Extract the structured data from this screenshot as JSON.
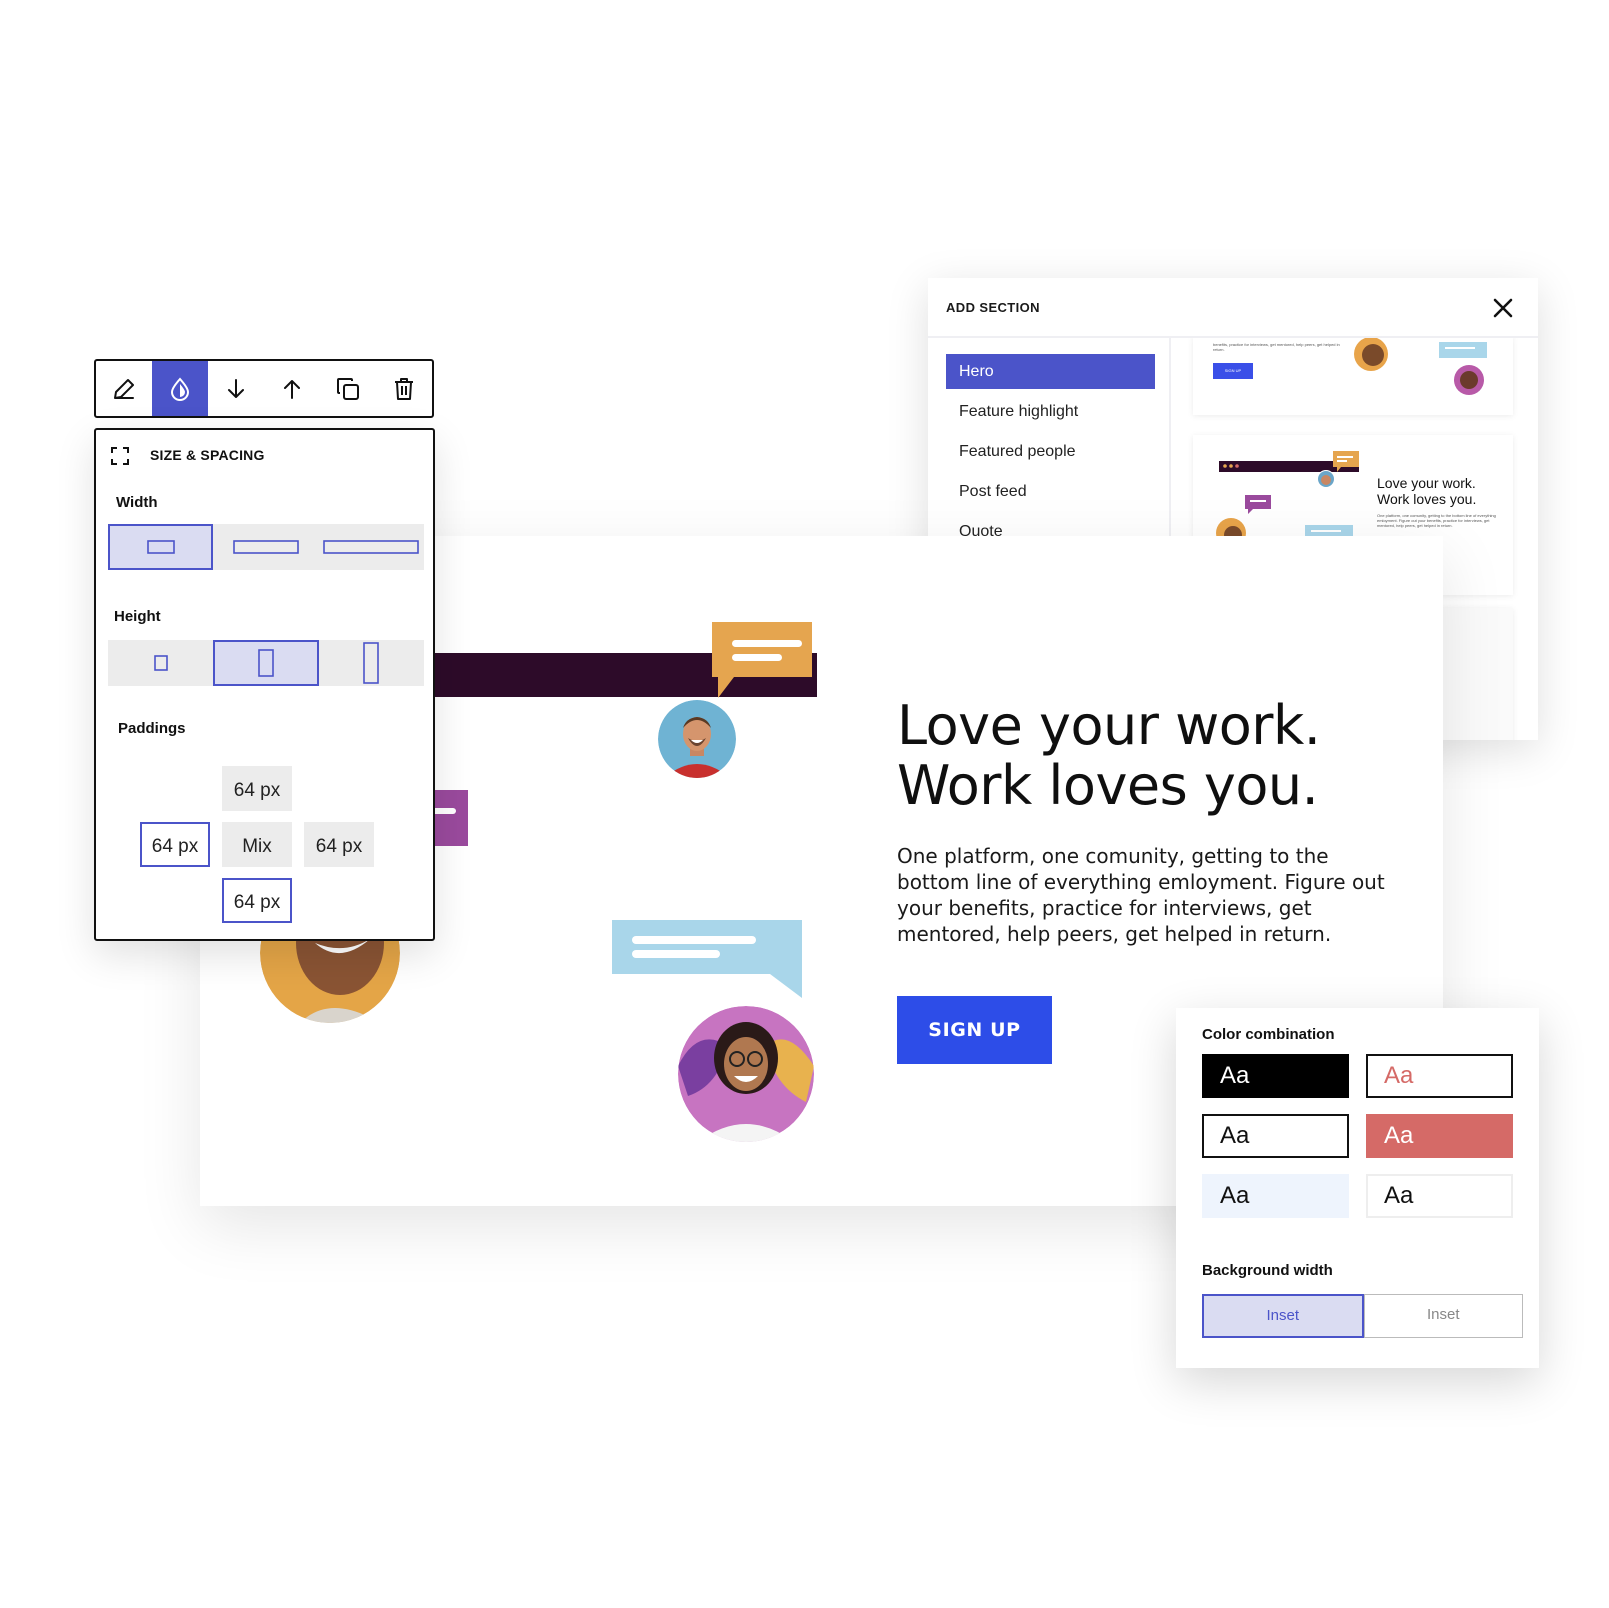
{
  "add_section": {
    "title": "ADD SECTION",
    "items": [
      {
        "label": "Hero",
        "active": true
      },
      {
        "label": "Feature highlight",
        "active": false
      },
      {
        "label": "Featured people",
        "active": false
      },
      {
        "label": "Post feed",
        "active": false
      },
      {
        "label": "Quote",
        "active": false
      }
    ],
    "preview_1": {
      "text": "benefits, practice for interviews, get mentored, help peers, get helped in return.",
      "button": "SIGN UP"
    },
    "preview_2": {
      "title_line1": "Love your work.",
      "title_line2": "Work loves you.",
      "text": "One platform, one comunity, getting to the bottom line of everything emloyment. Figure out your benefits, practice for interviews, get mentored, help peers, get helped in return."
    }
  },
  "hero": {
    "headline_line1": "Love your work.",
    "headline_line2": "Work loves you.",
    "body": "One platform, one comunity, getting to the bottom line of everything emloyment.  Figure out your benefits, practice for interviews, get mentored, help peers, get helped in return.",
    "cta": "SIGN UP"
  },
  "toolbar": {
    "tools": [
      "pencil-icon",
      "droplet-icon",
      "arrow-down-icon",
      "arrow-up-icon",
      "duplicate-icon",
      "trash-icon"
    ],
    "active": "droplet-icon"
  },
  "size_spacing": {
    "title": "SIZE & SPACING",
    "width_label": "Width",
    "width_selected": 0,
    "height_label": "Height",
    "height_selected": 1,
    "paddings_label": "Paddings",
    "padding_top": "64 px",
    "padding_left": "64 px",
    "padding_center": "Mix",
    "padding_right": "64 px",
    "padding_bottom": "64 px"
  },
  "color_panel": {
    "title": "Color combination",
    "swatches": [
      {
        "label": "Aa",
        "bg": "#000000",
        "fg": "#ffffff",
        "border": "#000000"
      },
      {
        "label": "Aa",
        "bg": "#ffffff",
        "fg": "#d56a67",
        "border": "#111111"
      },
      {
        "label": "Aa",
        "bg": "#ffffff",
        "fg": "#111111",
        "border": "#111111"
      },
      {
        "label": "Aa",
        "bg": "#d56a67",
        "fg": "#ffffff",
        "border": "#d56a67"
      },
      {
        "label": "Aa",
        "bg": "#eef4fd",
        "fg": "#111111",
        "border": "#eef4fd"
      },
      {
        "label": "Aa",
        "bg": "#ffffff",
        "fg": "#111111",
        "border": "#eeeeee"
      }
    ],
    "bg_width_label": "Background width",
    "bg_options": [
      "Inset",
      "Inset"
    ],
    "bg_selected": 0
  },
  "colors": {
    "accent": "#4b54c9",
    "cta": "#2d4de8",
    "dark_bar": "#2d0b29",
    "bubble_orange": "#e5a54f",
    "bubble_blue": "#a9d6ea",
    "bubble_purple": "#9a4a9d"
  }
}
